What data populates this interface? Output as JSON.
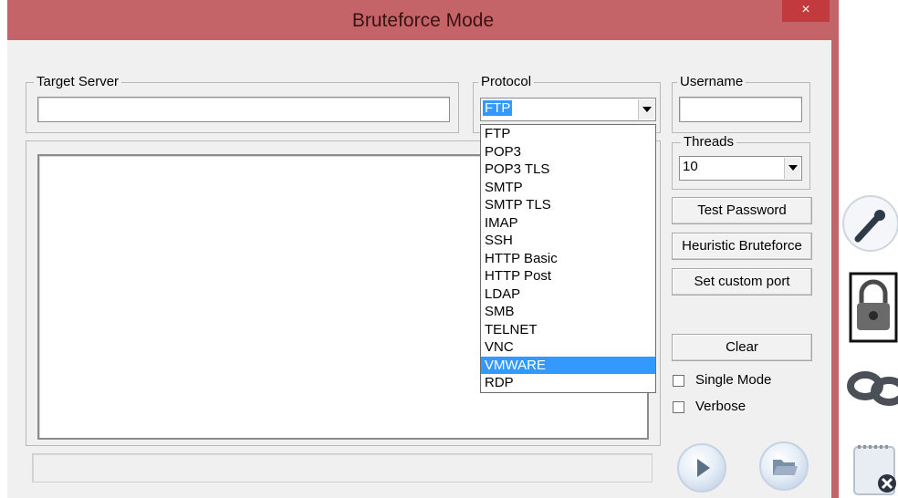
{
  "window": {
    "title": "Bruteforce Mode",
    "close_glyph": "×"
  },
  "target_server": {
    "label": "Target Server",
    "value": ""
  },
  "protocol": {
    "label": "Protocol",
    "selected": "FTP",
    "options": [
      "FTP",
      "POP3",
      "POP3 TLS",
      "SMTP",
      "SMTP TLS",
      "IMAP",
      "SSH",
      "HTTP Basic",
      "HTTP Post",
      "LDAP",
      "SMB",
      "TELNET",
      "VNC",
      "VMWARE",
      "RDP"
    ],
    "highlighted": "VMWARE"
  },
  "username": {
    "label": "Username",
    "value": ""
  },
  "threads": {
    "label": "Threads",
    "value": "10"
  },
  "buttons": {
    "test_password": "Test Password",
    "heuristic": "Heuristic Bruteforce",
    "custom_port": "Set custom port",
    "clear": "Clear"
  },
  "options": {
    "single_mode": "Single Mode",
    "verbose": "Verbose"
  },
  "icons": {
    "start": "play-icon",
    "open": "folder-icon",
    "side": [
      "key-icon",
      "padlock-icon",
      "handcuffs-icon",
      "notepad-delete-icon"
    ]
  },
  "colors": {
    "titlebar": "#c56468",
    "close": "#c23a3e",
    "selection": "#3399ff",
    "dialog": "#f0f0f0"
  }
}
